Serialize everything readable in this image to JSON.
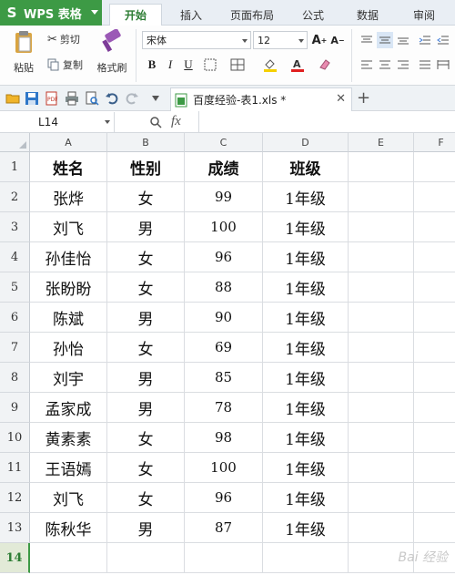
{
  "app": {
    "name": "WPS 表格"
  },
  "tabs": [
    {
      "label": "开始",
      "active": true
    },
    {
      "label": "插入",
      "active": false
    },
    {
      "label": "页面布局",
      "active": false
    },
    {
      "label": "公式",
      "active": false
    },
    {
      "label": "数据",
      "active": false
    },
    {
      "label": "审阅",
      "active": false
    }
  ],
  "ribbon": {
    "paste": "粘贴",
    "cut": "剪切",
    "copy": "复制",
    "format_painter": "格式刷",
    "font_name": "宋体",
    "font_size": "12",
    "bold": "B",
    "italic": "I",
    "underline": "U"
  },
  "document": {
    "tab_title": "百度经验-表1.xls *"
  },
  "formula_bar": {
    "name_box": "L14",
    "fx": "fx"
  },
  "columns": [
    "A",
    "B",
    "C",
    "D",
    "E",
    "F"
  ],
  "rows": [
    [
      "姓名",
      "性别",
      "成绩",
      "班级"
    ],
    [
      "张烨",
      "女",
      "99",
      "1年级"
    ],
    [
      "刘飞",
      "男",
      "100",
      "1年级"
    ],
    [
      "孙佳怡",
      "女",
      "96",
      "1年级"
    ],
    [
      "张盼盼",
      "女",
      "88",
      "1年级"
    ],
    [
      "陈斌",
      "男",
      "90",
      "1年级"
    ],
    [
      "孙怡",
      "女",
      "69",
      "1年级"
    ],
    [
      "刘宇",
      "男",
      "85",
      "1年级"
    ],
    [
      "孟家成",
      "男",
      "78",
      "1年级"
    ],
    [
      "黄素素",
      "女",
      "98",
      "1年级"
    ],
    [
      "王语嫣",
      "女",
      "100",
      "1年级"
    ],
    [
      "刘飞",
      "女",
      "96",
      "1年级"
    ],
    [
      "陈秋华",
      "男",
      "87",
      "1年级"
    ],
    [
      "",
      "",
      "",
      ""
    ]
  ],
  "row_numbers": [
    "1",
    "2",
    "3",
    "4",
    "5",
    "6",
    "7",
    "8",
    "9",
    "10",
    "11",
    "12",
    "13",
    "14"
  ],
  "selected_row": "14",
  "watermark": "Bai 经验",
  "colors": {
    "accent": "#3d9a45",
    "header_bg": "#f1f3f5"
  }
}
